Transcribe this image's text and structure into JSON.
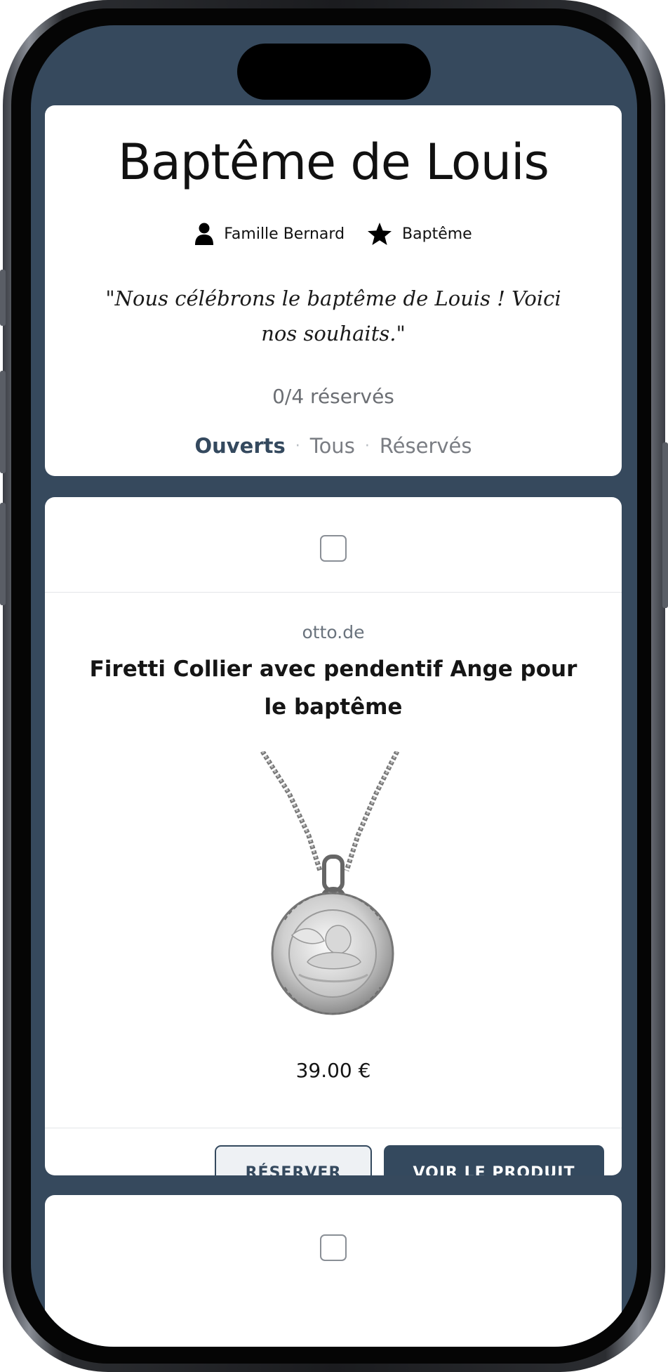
{
  "header": {
    "title": "Baptême de Louis",
    "family_label": "Famille Bernard",
    "family_icon": "person-icon",
    "event_label": "Baptême",
    "event_icon": "star-icon",
    "quote": "\"Nous célébrons le baptême de Louis ! Voici nos souhaits.\"",
    "reserved_count": "0/4 réservés",
    "filters": [
      {
        "label": "Ouverts",
        "active": true
      },
      {
        "label": "Tous",
        "active": false
      },
      {
        "label": "Réservés",
        "active": false
      }
    ]
  },
  "product": {
    "checked": false,
    "store": "otto.de",
    "title": "Firetti Collier avec pendentif Ange pour le baptême",
    "image_icon": "angel-pendant-necklace",
    "price": "39.00 €",
    "reserve_label": "RÉSERVER",
    "view_label": "VOIR LE PRODUIT"
  },
  "next_item": {
    "checked": false
  },
  "colors": {
    "background": "#36495d",
    "accent": "#34495e",
    "card": "#ffffff"
  }
}
